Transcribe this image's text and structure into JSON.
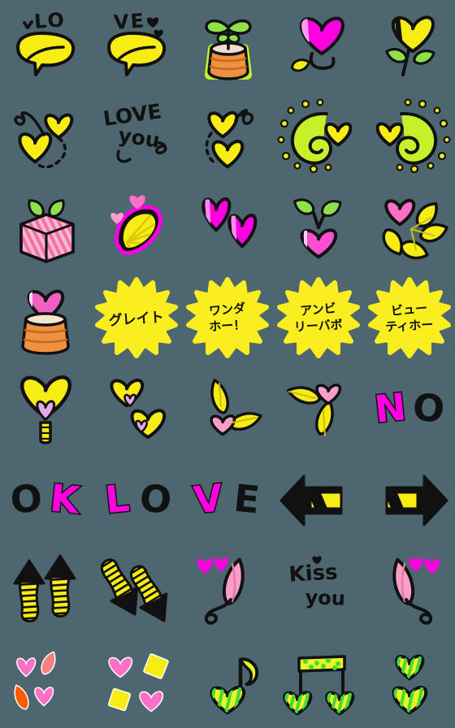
{
  "sheet": {
    "title": "Emoji Sticker Sheet",
    "columns": 5,
    "rows": 8,
    "cell_size": 112,
    "background_color": "#4d6670"
  },
  "palette": {
    "background": "#4d6670",
    "yellow": "#f7ec13",
    "yellow_deep": "#ffe800",
    "magenta": "#ff00e0",
    "pink": "#ff6ec7",
    "pink_soft": "#f89ec8",
    "pink_pale": "#f7b8d8",
    "green": "#8fe04a",
    "green_lime": "#c6f02a",
    "orange": "#f0913f",
    "orange_deep": "#ff5a00",
    "lavender": "#e2a8e8",
    "salmon": "#f97f7f",
    "black": "#111111",
    "white": "#ffffff"
  },
  "stickers": [
    {
      "id": 1,
      "row": 1,
      "col": 1,
      "name": "speech-bubble-lo",
      "label": "♥LO",
      "kind": "bubble-text",
      "text": "LO",
      "text_color": "#111111",
      "fill": "#f7ec13"
    },
    {
      "id": 2,
      "row": 1,
      "col": 2,
      "name": "speech-bubble-ve",
      "label": "VE♥",
      "kind": "bubble-text",
      "text": "VE",
      "text_color": "#111111",
      "fill": "#f7ec13"
    },
    {
      "id": 3,
      "row": 1,
      "col": 3,
      "name": "potted-sprout",
      "label": "potted sprout",
      "kind": "plant",
      "text": "",
      "text_color": "",
      "fill": "#f0913f"
    },
    {
      "id": 4,
      "row": 1,
      "col": 4,
      "name": "magenta-heart-flower",
      "label": "magenta heart flower",
      "kind": "flower-heart",
      "text": "",
      "text_color": "",
      "fill": "#ff00e0"
    },
    {
      "id": 5,
      "row": 1,
      "col": 5,
      "name": "yellow-heart-flower",
      "label": "yellow heart flower",
      "kind": "flower-heart2",
      "text": "",
      "text_color": "",
      "fill": "#f7ec13"
    },
    {
      "id": 6,
      "row": 2,
      "col": 1,
      "name": "two-hearts-swirl-left",
      "label": "two hearts with swirl",
      "kind": "hearts-swirl",
      "text": "",
      "text_color": "",
      "fill": "#f7ec13"
    },
    {
      "id": 7,
      "row": 2,
      "col": 2,
      "name": "love-you-text",
      "label": "LOVE you",
      "kind": "text-script",
      "text": "LOVE you",
      "text_color": "#111111",
      "fill": ""
    },
    {
      "id": 8,
      "row": 2,
      "col": 3,
      "name": "two-hearts-swirl-right",
      "label": "two hearts with swirl",
      "kind": "hearts-swirl2",
      "text": "",
      "text_color": "",
      "fill": "#f7ec13"
    },
    {
      "id": 9,
      "row": 2,
      "col": 4,
      "name": "swirl-heart-sparkle-left",
      "label": "swirl heart sparkle",
      "kind": "swirl-sparkle",
      "text": "",
      "text_color": "",
      "fill": "#c6f02a"
    },
    {
      "id": 10,
      "row": 2,
      "col": 5,
      "name": "swirl-heart-sparkle-right",
      "label": "swirl heart sparkle",
      "kind": "swirl-sparkle2",
      "text": "",
      "text_color": "",
      "fill": "#c6f02a"
    },
    {
      "id": 11,
      "row": 3,
      "col": 1,
      "name": "gift-box",
      "label": "striped gift box",
      "kind": "gift",
      "text": "",
      "text_color": "",
      "fill": "#f7b8d8"
    },
    {
      "id": 12,
      "row": 3,
      "col": 2,
      "name": "lemon-slice",
      "label": "lemon slice",
      "kind": "lemon",
      "text": "",
      "text_color": "",
      "fill": "#f7ec13"
    },
    {
      "id": 13,
      "row": 3,
      "col": 3,
      "name": "magenta-striped-hearts",
      "label": "two magenta hearts",
      "kind": "hearts-pair",
      "text": "",
      "text_color": "",
      "fill": "#ff00e0"
    },
    {
      "id": 14,
      "row": 3,
      "col": 4,
      "name": "cherry-heart",
      "label": "heart cherry",
      "kind": "cherry",
      "text": "",
      "text_color": "",
      "fill": "#ff4fd0"
    },
    {
      "id": 15,
      "row": 3,
      "col": 5,
      "name": "pink-yellow-flower",
      "label": "pink and yellow flower",
      "kind": "flower5",
      "text": "",
      "text_color": "",
      "fill": "#f7ec13"
    },
    {
      "id": 16,
      "row": 4,
      "col": 1,
      "name": "heart-in-sack",
      "label": "heart in sack",
      "kind": "sack",
      "text": "",
      "text_color": "",
      "fill": "#f0913f"
    },
    {
      "id": 17,
      "row": 4,
      "col": 2,
      "name": "burst-great",
      "label": "グレイト",
      "kind": "burst",
      "text": "グレイト",
      "text_color": "#111111",
      "fill": "#fbee20"
    },
    {
      "id": 18,
      "row": 4,
      "col": 3,
      "name": "burst-wonderful",
      "label": "ワンダホー！",
      "kind": "burst2",
      "text": "ワンダ\nホー！",
      "text_color": "#111111",
      "fill": "#fbee20"
    },
    {
      "id": 19,
      "row": 4,
      "col": 4,
      "name": "burst-unbelievable",
      "label": "アンビリーバボ",
      "kind": "burst2",
      "text": "アンビ\nリーバボ",
      "text_color": "#111111",
      "fill": "#fbee20"
    },
    {
      "id": 20,
      "row": 4,
      "col": 5,
      "name": "burst-beautiful",
      "label": "ビューティホー",
      "kind": "burst2",
      "text": "ビュー\nティホー",
      "text_color": "#111111",
      "fill": "#fbee20"
    },
    {
      "id": 21,
      "row": 5,
      "col": 1,
      "name": "heart-balloon",
      "label": "heart balloon",
      "kind": "balloon",
      "text": "",
      "text_color": "",
      "fill": "#f7ec13"
    },
    {
      "id": 22,
      "row": 5,
      "col": 2,
      "name": "two-yellow-hearts",
      "label": "two yellow hearts",
      "kind": "hearts-duo",
      "text": "",
      "text_color": "",
      "fill": "#f7ec13"
    },
    {
      "id": 23,
      "row": 5,
      "col": 3,
      "name": "leaf-trio-down",
      "label": "leaf trio",
      "kind": "leaf-trio",
      "text": "",
      "text_color": "",
      "fill": "#f7ec13"
    },
    {
      "id": 24,
      "row": 5,
      "col": 4,
      "name": "leaf-trio-up",
      "label": "leaf trio",
      "kind": "leaf-trio2",
      "text": "",
      "text_color": "",
      "fill": "#f7ec13"
    },
    {
      "id": 25,
      "row": 5,
      "col": 5,
      "name": "word-no",
      "label": "NO",
      "kind": "word",
      "text": "NO",
      "text_color": "#111111",
      "fill": "#ff00e0"
    },
    {
      "id": 26,
      "row": 6,
      "col": 1,
      "name": "word-ok",
      "label": "OK",
      "kind": "word",
      "text": "OK",
      "text_color": "#111111",
      "fill": "#ff00e0"
    },
    {
      "id": 27,
      "row": 6,
      "col": 2,
      "name": "word-lo",
      "label": "LO",
      "kind": "word",
      "text": "LO",
      "text_color": "#111111",
      "fill": "#ff00e0"
    },
    {
      "id": 28,
      "row": 6,
      "col": 3,
      "name": "word-ve",
      "label": "VE",
      "kind": "word",
      "text": "VE",
      "text_color": "#111111",
      "fill": "#ff00e0"
    },
    {
      "id": 29,
      "row": 6,
      "col": 4,
      "name": "arrow-left",
      "label": "left arrow",
      "kind": "arrow-left",
      "text": "",
      "text_color": "",
      "fill": "#f7ec13"
    },
    {
      "id": 30,
      "row": 6,
      "col": 5,
      "name": "arrow-right",
      "label": "right arrow",
      "kind": "arrow-right",
      "text": "",
      "text_color": "",
      "fill": "#f7ec13"
    },
    {
      "id": 31,
      "row": 7,
      "col": 1,
      "name": "arrows-up",
      "label": "two up arrows",
      "kind": "arrows-up",
      "text": "",
      "text_color": "",
      "fill": "#f7ec13"
    },
    {
      "id": 32,
      "row": 7,
      "col": 2,
      "name": "arrows-down",
      "label": "two down arrows",
      "kind": "arrows-down",
      "text": "",
      "text_color": "",
      "fill": "#f7ec13"
    },
    {
      "id": 33,
      "row": 7,
      "col": 3,
      "name": "petal-swirl-left",
      "label": "petal and swirl",
      "kind": "petal-swirl",
      "text": "",
      "text_color": "",
      "fill": "#f89ec8"
    },
    {
      "id": 34,
      "row": 7,
      "col": 4,
      "name": "kiss-you-text",
      "label": "Kiss you",
      "kind": "text-script",
      "text": "Kiss you",
      "text_color": "#111111",
      "fill": ""
    },
    {
      "id": 35,
      "row": 7,
      "col": 5,
      "name": "petal-swirl-right",
      "label": "petal and swirl",
      "kind": "petal-swirl2",
      "text": "",
      "text_color": "",
      "fill": "#f89ec8"
    },
    {
      "id": 36,
      "row": 8,
      "col": 1,
      "name": "confetti-hearts-pink",
      "label": "pink confetti hearts",
      "kind": "confetti1",
      "text": "",
      "text_color": "",
      "fill": "#ff6ec7"
    },
    {
      "id": 37,
      "row": 8,
      "col": 2,
      "name": "confetti-hearts-diamonds",
      "label": "hearts and diamonds",
      "kind": "confetti2",
      "text": "",
      "text_color": "",
      "fill": "#f7ec13"
    },
    {
      "id": 38,
      "row": 8,
      "col": 3,
      "name": "eighth-note-heart",
      "label": "eighth note",
      "kind": "note-eighth",
      "text": "",
      "text_color": "",
      "fill": "#e8f520"
    },
    {
      "id": 39,
      "row": 8,
      "col": 4,
      "name": "beamed-notes-heart",
      "label": "beamed notes",
      "kind": "note-beamed",
      "text": "",
      "text_color": "",
      "fill": "#e8f520"
    },
    {
      "id": 40,
      "row": 8,
      "col": 5,
      "name": "stacked-hearts",
      "label": "stacked hearts",
      "kind": "hearts-stack",
      "text": "",
      "text_color": "",
      "fill": "#e8f520"
    }
  ]
}
